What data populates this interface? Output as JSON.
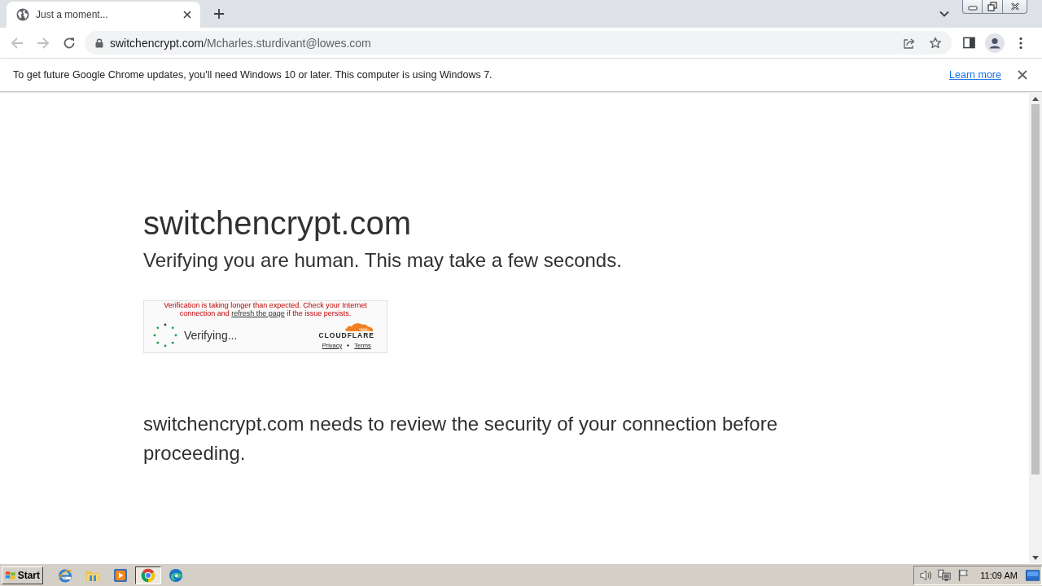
{
  "tabs": [
    {
      "title": "Just a moment...",
      "selected": true
    }
  ],
  "navigation": {
    "back_disabled": true,
    "forward_disabled": true
  },
  "address_bar": {
    "host": "switchencrypt.com",
    "path": "/Mcharles.sturdivant@lowes.com"
  },
  "info_bar": {
    "message": "To get future Google Chrome updates, you'll need Windows 10 or later. This computer is using Windows 7.",
    "link": "Learn more"
  },
  "page": {
    "heading": "switchencrypt.com",
    "subheading": "Verifying you are human. This may take a few seconds.",
    "challenge": {
      "warning_start": "Verification is taking longer than expected. Check your Internet connection and",
      "warning_link": "refresh the page",
      "warning_end": "if the issue persists.",
      "status": "Verifying...",
      "brand": "CLOUDFLARE",
      "privacy": "Privacy",
      "terms": "Terms"
    },
    "notice": "switchencrypt.com needs to review the security of your connection before proceeding."
  },
  "taskbar": {
    "start": "Start",
    "apps": [
      {
        "kind": "ie",
        "selected": false
      },
      {
        "kind": "explorer",
        "selected": false
      },
      {
        "kind": "media",
        "selected": false
      },
      {
        "kind": "chrome",
        "selected": true
      },
      {
        "kind": "edge",
        "selected": false
      }
    ],
    "clock": "11:09 AM"
  }
}
